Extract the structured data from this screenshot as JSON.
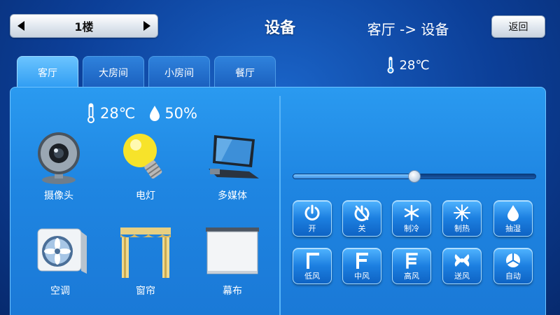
{
  "header": {
    "floor_label": "1楼",
    "title": "设备",
    "back_label": "返回"
  },
  "tabs": [
    {
      "label": "客厅",
      "active": true
    },
    {
      "label": "大房间",
      "active": false
    },
    {
      "label": "小房间",
      "active": false
    },
    {
      "label": "餐厅",
      "active": false
    }
  ],
  "environment": {
    "temperature": "28℃",
    "humidity": "50%"
  },
  "devices": [
    {
      "label": "摄像头",
      "icon": "camera-icon"
    },
    {
      "label": "电灯",
      "icon": "light-bulb-icon"
    },
    {
      "label": "多媒体",
      "icon": "multimedia-icon"
    },
    {
      "label": "空调",
      "icon": "air-conditioner-icon"
    },
    {
      "label": "窗帘",
      "icon": "curtain-icon"
    },
    {
      "label": "幕布",
      "icon": "projector-screen-icon"
    }
  ],
  "control": {
    "title": "客厅 -> 设备",
    "set_temperature": "28℃",
    "slider_fraction": 0.5,
    "buttons": [
      {
        "label": "开",
        "icon": "power-icon"
      },
      {
        "label": "关",
        "icon": "power-off-icon"
      },
      {
        "label": "制冷",
        "icon": "snowflake-icon"
      },
      {
        "label": "制热",
        "icon": "sun-icon"
      },
      {
        "label": "抽湿",
        "icon": "droplet-icon"
      },
      {
        "label": "低风",
        "icon": "fan-low-icon"
      },
      {
        "label": "中风",
        "icon": "fan-medium-icon"
      },
      {
        "label": "高风",
        "icon": "fan-high-icon"
      },
      {
        "label": "送风",
        "icon": "fan-icon"
      },
      {
        "label": "自动",
        "icon": "auto-icon"
      }
    ]
  },
  "colors": {
    "background": "#0c3f98",
    "panel": "#1f86e2",
    "active_tab": "#2e9cf2"
  }
}
